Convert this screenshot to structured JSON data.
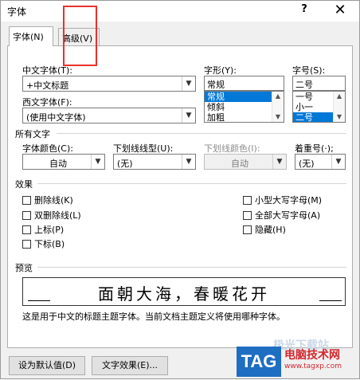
{
  "window": {
    "title": "字体",
    "help_label": "?",
    "close_label": "✕"
  },
  "tabs": [
    {
      "label": "字体(N)",
      "active": true
    },
    {
      "label": "高级(V)",
      "active": false
    }
  ],
  "font_section": {
    "chinese_font_label": "中文字体(T):",
    "chinese_font_value": "+中文标题",
    "western_font_label": "西文字体(F):",
    "western_font_value": "(使用中文字体)",
    "style_label": "字形(Y):",
    "style_value": "常规",
    "style_options": [
      "常规",
      "倾斜",
      "加粗"
    ],
    "style_selected": "常规",
    "size_label": "字号(S):",
    "size_value": "二号",
    "size_options": [
      "一号",
      "小一",
      "二号"
    ],
    "size_selected": "二号"
  },
  "all_text": {
    "group_title": "所有文字",
    "font_color_label": "字体颜色(C):",
    "font_color_value": "自动",
    "underline_type_label": "下划线线型(U):",
    "underline_type_value": "(无)",
    "underline_color_label": "下划线颜色(I):",
    "underline_color_value": "自动",
    "emphasis_label": "着重号(·);",
    "emphasis_value": "(无)"
  },
  "effects": {
    "group_title": "效果",
    "left": [
      "删除线(K)",
      "双删除线(L)",
      "上标(P)",
      "下标(B)"
    ],
    "right": [
      "小型大写字母(M)",
      "全部大写字母(A)",
      "隐藏(H)"
    ]
  },
  "preview": {
    "group_title": "预览",
    "sample_text": "面朝大海，春暖花开",
    "description": "这是用于中文的标题主题字体。当前文档主题定义将使用哪种字体。"
  },
  "buttons": {
    "set_default": "设为默认值(D)",
    "text_effects": "文字效果(E)..."
  },
  "watermark": {
    "tag": "TAG",
    "title": "电脑技术网",
    "url": "www.tagxp.com",
    "faint": "极光下载站"
  },
  "colors": {
    "selection": "#0078d7",
    "highlight_box": "#e8322b",
    "watermark_blue": "#1e6ec2",
    "watermark_red": "#d2282e"
  }
}
